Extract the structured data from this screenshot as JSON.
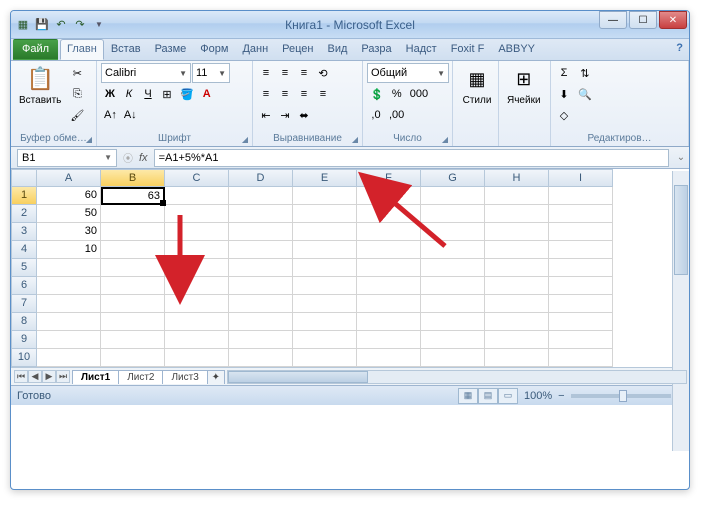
{
  "window": {
    "title": "Книга1 - Microsoft Excel"
  },
  "qat": {
    "save": "💾",
    "undo": "↶",
    "redo": "↷"
  },
  "win_controls": {
    "min": "—",
    "max": "☐",
    "close": "✕"
  },
  "tabs": {
    "file": "Файл",
    "home": "Главн",
    "insert": "Встав",
    "layout": "Разме",
    "formulas": "Форм",
    "data": "Данн",
    "review": "Рецен",
    "view": "Вид",
    "dev": "Разра",
    "addins": "Надст",
    "foxit": "Foxit F",
    "abbyy": "ABBYY",
    "help": "?"
  },
  "ribbon": {
    "clipboard": {
      "paste": "Вставить",
      "label": "Буфер обме…"
    },
    "font": {
      "name": "Calibri",
      "size": "11",
      "bold": "Ж",
      "italic": "К",
      "underline": "Ч",
      "label": "Шрифт"
    },
    "align": {
      "wrap": "≡",
      "merge": "⬌",
      "label": "Выравнивание"
    },
    "number": {
      "format": "Общий",
      "currency": "💲",
      "percent": "%",
      "comma": "000",
      "inc": ",0",
      "dec": ",00",
      "label": "Число"
    },
    "styles": {
      "label": "Стили"
    },
    "cells": {
      "label": "Ячейки"
    },
    "editing": {
      "sum": "Σ",
      "fill": "⬇",
      "clear": "◇",
      "label": "Редактиров…"
    }
  },
  "formula_bar": {
    "name_box": "B1",
    "fx": "fx",
    "formula": "=A1+5%*A1"
  },
  "columns": [
    "A",
    "B",
    "C",
    "D",
    "E",
    "F",
    "G",
    "H",
    "I"
  ],
  "rows_count": 10,
  "cells": {
    "A1": "60",
    "B1": "63",
    "A2": "50",
    "A3": "30",
    "A4": "10"
  },
  "active_cell": "B1",
  "sheet_tabs": {
    "s1": "Лист1",
    "s2": "Лист2",
    "s3": "Лист3"
  },
  "status": {
    "ready": "Готово",
    "zoom": "100%",
    "minus": "−",
    "plus": "+"
  },
  "colors": {
    "arrow": "#d3222a"
  }
}
